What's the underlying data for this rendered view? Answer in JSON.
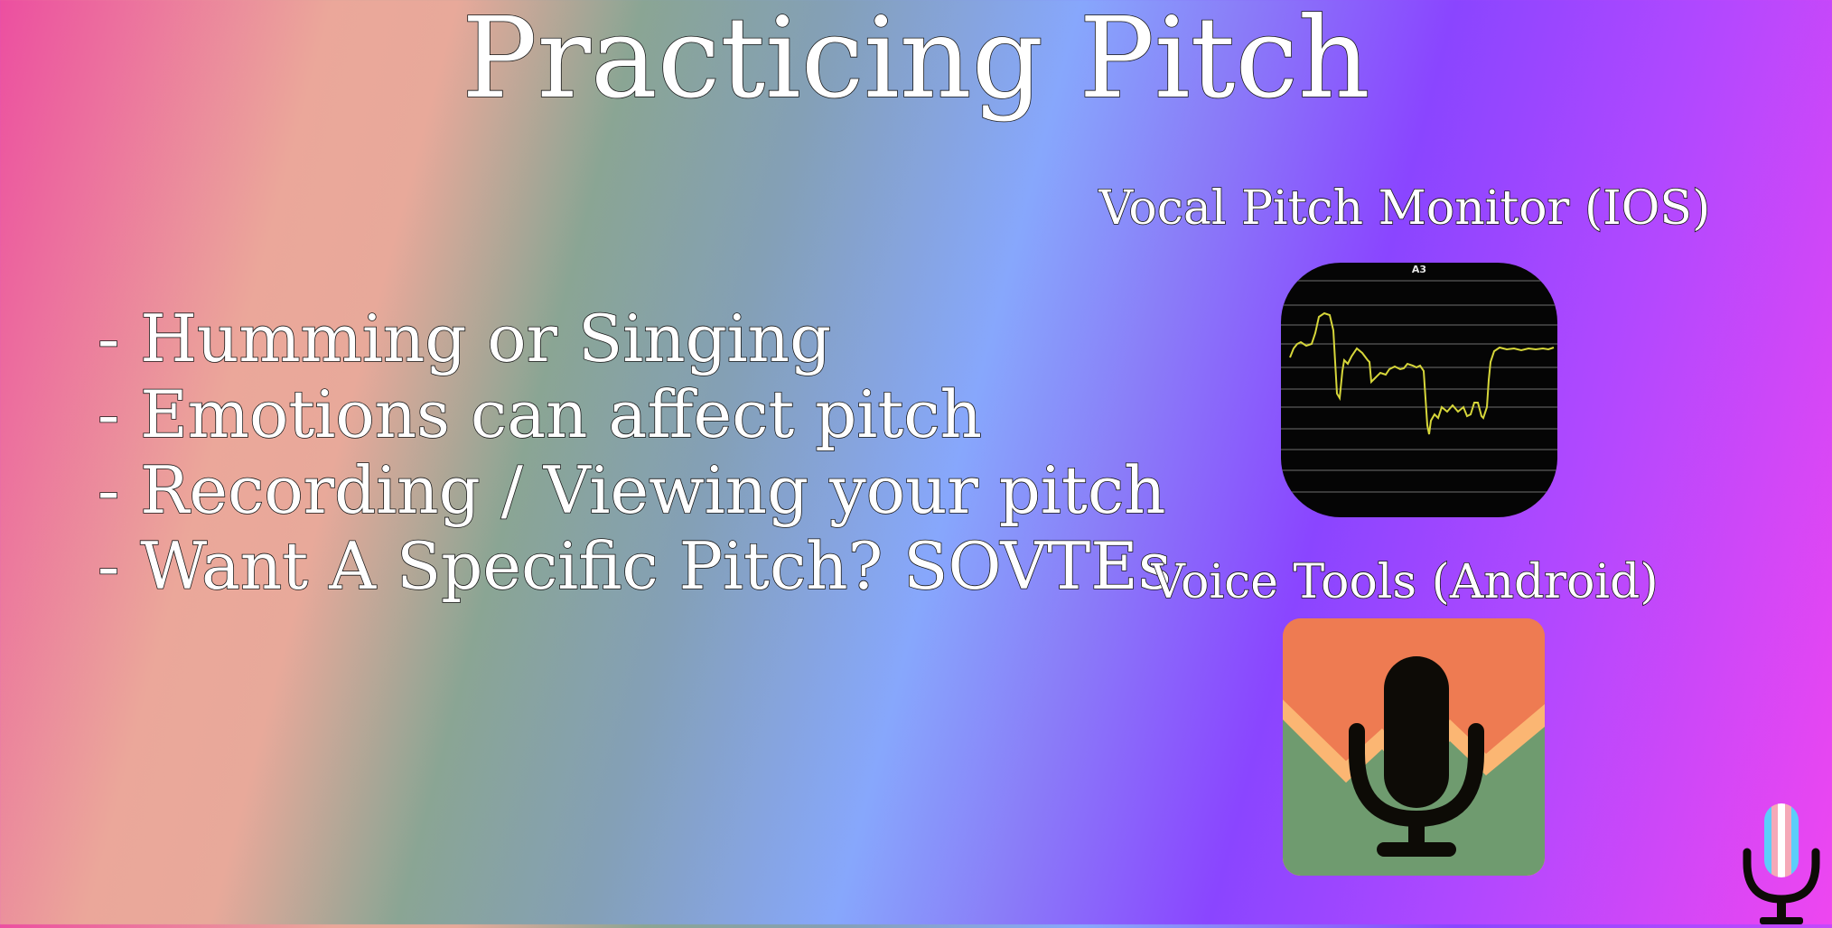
{
  "slide": {
    "title": "Practicing Pitch",
    "bullets": [
      "- Humming or Singing",
      "- Emotions can affect pitch",
      "- Recording / Viewing your pitch",
      "- Want A Specific Pitch? SOVTEs"
    ]
  },
  "apps": {
    "ios": {
      "label": "Vocal Pitch Monitor (IOS)",
      "icon_note": "A3",
      "icon": "pitch-graph-icon"
    },
    "android": {
      "label": "Voice Tools (Android)",
      "icon": "microphone-icon"
    }
  },
  "logo": {
    "icon": "trans-flag-microphone-icon"
  },
  "colors": {
    "text": "#ffffff",
    "text_outline": "#1a1a1a",
    "pitch_line": "#d6d63a",
    "android_orange": "#ee7b52",
    "android_peach": "#fbb673",
    "android_green": "#6f9b6f",
    "flag_blue": "#5bcefa",
    "flag_pink": "#f5a9b8",
    "flag_white": "#ffffff"
  }
}
